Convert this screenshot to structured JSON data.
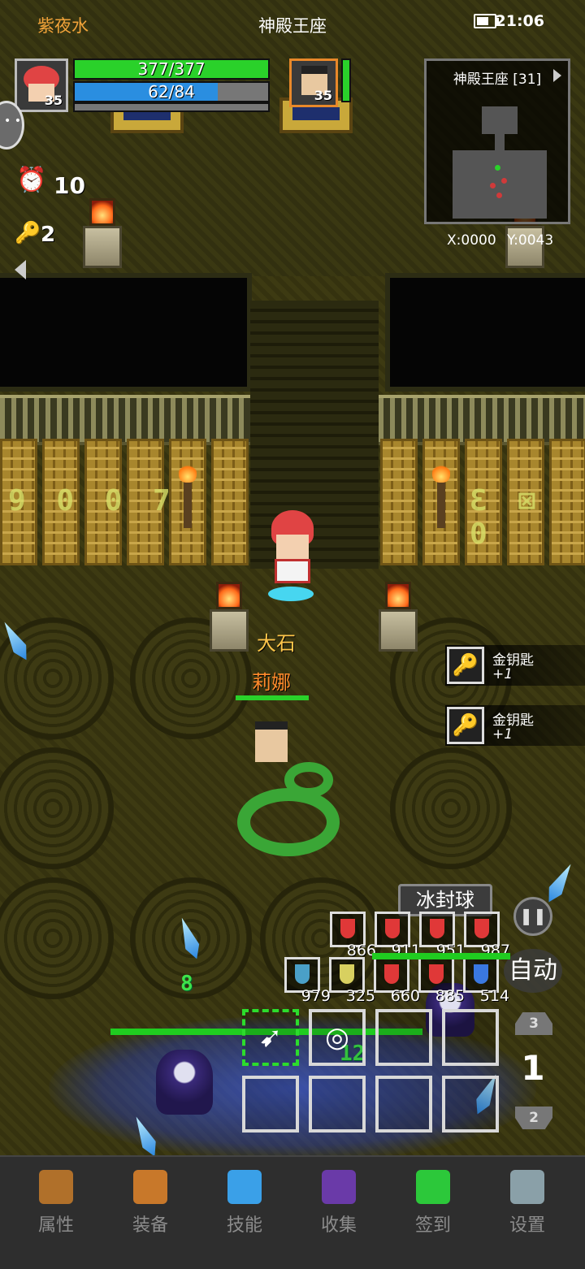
{
  "status": {
    "player_name": "紫夜水",
    "map_name": "神殿王座",
    "time": "21:06"
  },
  "player": {
    "level": "35",
    "hp": "377/377",
    "hp_fraction": 1.0,
    "mp": "62/84",
    "mp_fraction": 0.738
  },
  "companion": {
    "level": "35",
    "hp_fraction": 1.0
  },
  "counters": {
    "timer_value": "10",
    "key_value": "2"
  },
  "minimap": {
    "title": "神殿王座 [31]",
    "coords": "X:0000 Y:0043"
  },
  "scene": {
    "runes_left": "9 0 0 7",
    "runes_right": "Ɛ ⊠ 0",
    "pet_name": "大石",
    "npc_name": "莉娜",
    "damage_1": "8",
    "damage_2": "12",
    "damage_3": "12"
  },
  "loot": [
    {
      "name": "金钥匙",
      "amount": "+1"
    },
    {
      "name": "金钥匙",
      "amount": "+1"
    }
  ],
  "skill": {
    "current": "冰封球"
  },
  "controls": {
    "auto_label": "自动",
    "page_up": "3",
    "page_current": "1",
    "page_down": "2"
  },
  "potions_row1": [
    {
      "count": "866",
      "color": "#e03838"
    },
    {
      "count": "911",
      "color": "#e03838"
    },
    {
      "count": "951",
      "color": "#e03838"
    },
    {
      "count": "987",
      "color": "#e03838"
    }
  ],
  "potions_row2": [
    {
      "count": "979",
      "color": "#4aa0c8",
      "icon": "fish-icon"
    },
    {
      "count": "325",
      "color": "#d8d060"
    },
    {
      "count": "660",
      "color": "#e03838"
    },
    {
      "count": "885",
      "color": "#e03838"
    },
    {
      "count": "514",
      "color": "#3a78e0"
    }
  ],
  "nav": [
    {
      "label": "属性",
      "icon": "helmet-icon",
      "color": "#b0702a"
    },
    {
      "label": "装备",
      "icon": "bag-icon",
      "color": "#c8782a"
    },
    {
      "label": "技能",
      "icon": "skill-orb-icon",
      "color": "#3aa0e8"
    },
    {
      "label": "收集",
      "icon": "collection-book-icon",
      "color": "#6a3aa8"
    },
    {
      "label": "签到",
      "icon": "gem-icon",
      "color": "#2cc83a"
    },
    {
      "label": "设置",
      "icon": "gear-icon",
      "color": "#8aa0a8"
    }
  ],
  "colors": {
    "hp": "#2ad12a",
    "mp": "#2a8ee0",
    "accent": "#f2a33a"
  }
}
